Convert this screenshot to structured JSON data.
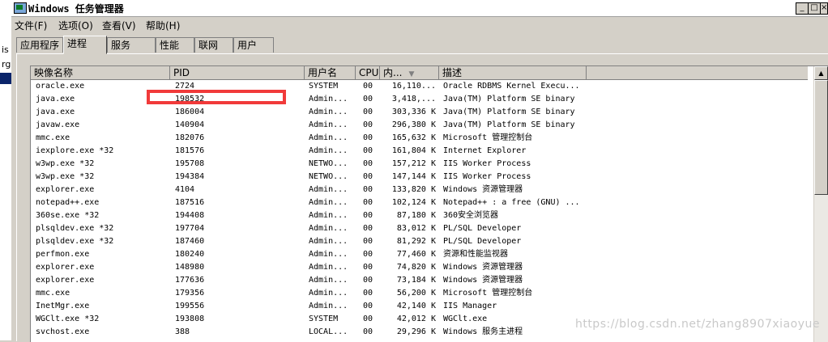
{
  "window": {
    "title": "Windows 任务管理器",
    "controls": {
      "minimize": "_",
      "maximize": "□",
      "close": "×"
    }
  },
  "menubar": [
    "文件(F)",
    "选项(O)",
    "查看(V)",
    "帮助(H)"
  ],
  "tabs": [
    "应用程序",
    "进程",
    "服务",
    "性能",
    "联网",
    "用户"
  ],
  "active_tab": "进程",
  "left_strip": {
    "t1": "is",
    "t2": "rg"
  },
  "columns": [
    "映像名称",
    "PID",
    "用户名",
    "CPU",
    "内...",
    "描述"
  ],
  "sort_indicator": "▼",
  "rows": [
    {
      "name": "oracle.exe",
      "pid": "2724",
      "user": "SYSTEM",
      "cpu": "00",
      "mem": "16,110...",
      "desc": "Oracle RDBMS Kernel Execu..."
    },
    {
      "name": "java.exe",
      "pid": "198532",
      "user": "Admin...",
      "cpu": "00",
      "mem": "3,418,...",
      "desc": "Java(TM) Platform SE binary"
    },
    {
      "name": "java.exe",
      "pid": "186004",
      "user": "Admin...",
      "cpu": "00",
      "mem": "303,336 K",
      "desc": "Java(TM) Platform SE binary"
    },
    {
      "name": "javaw.exe",
      "pid": "140904",
      "user": "Admin...",
      "cpu": "00",
      "mem": "296,380 K",
      "desc": "Java(TM) Platform SE binary"
    },
    {
      "name": "mmc.exe",
      "pid": "182076",
      "user": "Admin...",
      "cpu": "00",
      "mem": "165,632 K",
      "desc": "Microsoft 管理控制台"
    },
    {
      "name": "iexplore.exe *32",
      "pid": "181576",
      "user": "Admin...",
      "cpu": "00",
      "mem": "161,804 K",
      "desc": "Internet Explorer"
    },
    {
      "name": "w3wp.exe *32",
      "pid": "195708",
      "user": "NETWO...",
      "cpu": "00",
      "mem": "157,212 K",
      "desc": "IIS Worker Process"
    },
    {
      "name": "w3wp.exe *32",
      "pid": "194384",
      "user": "NETWO...",
      "cpu": "00",
      "mem": "147,144 K",
      "desc": "IIS Worker Process"
    },
    {
      "name": "explorer.exe",
      "pid": "4104",
      "user": "Admin...",
      "cpu": "00",
      "mem": "133,820 K",
      "desc": "Windows 资源管理器"
    },
    {
      "name": "notepad++.exe",
      "pid": "187516",
      "user": "Admin...",
      "cpu": "00",
      "mem": "102,124 K",
      "desc": "Notepad++ : a free (GNU) ..."
    },
    {
      "name": "360se.exe *32",
      "pid": "194408",
      "user": "Admin...",
      "cpu": "00",
      "mem": "87,180 K",
      "desc": "360安全浏览器"
    },
    {
      "name": "plsqldev.exe *32",
      "pid": "197704",
      "user": "Admin...",
      "cpu": "00",
      "mem": "83,012 K",
      "desc": "PL/SQL Developer"
    },
    {
      "name": "plsqldev.exe *32",
      "pid": "187460",
      "user": "Admin...",
      "cpu": "00",
      "mem": "81,292 K",
      "desc": "PL/SQL Developer"
    },
    {
      "name": "perfmon.exe",
      "pid": "180240",
      "user": "Admin...",
      "cpu": "00",
      "mem": "77,460 K",
      "desc": "资源和性能监视器"
    },
    {
      "name": "explorer.exe",
      "pid": "148980",
      "user": "Admin...",
      "cpu": "00",
      "mem": "74,820 K",
      "desc": "Windows 资源管理器"
    },
    {
      "name": "explorer.exe",
      "pid": "177636",
      "user": "Admin...",
      "cpu": "00",
      "mem": "73,184 K",
      "desc": "Windows 资源管理器"
    },
    {
      "name": "mmc.exe",
      "pid": "179356",
      "user": "Admin...",
      "cpu": "00",
      "mem": "56,200 K",
      "desc": "Microsoft 管理控制台"
    },
    {
      "name": "InetMgr.exe",
      "pid": "199556",
      "user": "Admin...",
      "cpu": "00",
      "mem": "42,140 K",
      "desc": "IIS Manager"
    },
    {
      "name": "WGClt.exe *32",
      "pid": "193808",
      "user": "SYSTEM",
      "cpu": "00",
      "mem": "42,012 K",
      "desc": "WGClt.exe"
    },
    {
      "name": "svchost.exe",
      "pid": "388",
      "user": "LOCAL...",
      "cpu": "00",
      "mem": "29,296 K",
      "desc": "Windows 服务主进程"
    }
  ],
  "watermark": "https://blog.csdn.net/zhang8907xiaoyue",
  "colors": {
    "highlight": "#f13a3a",
    "titlebar_bg": "#ffffff",
    "window_bg": "#d4d0c8"
  }
}
